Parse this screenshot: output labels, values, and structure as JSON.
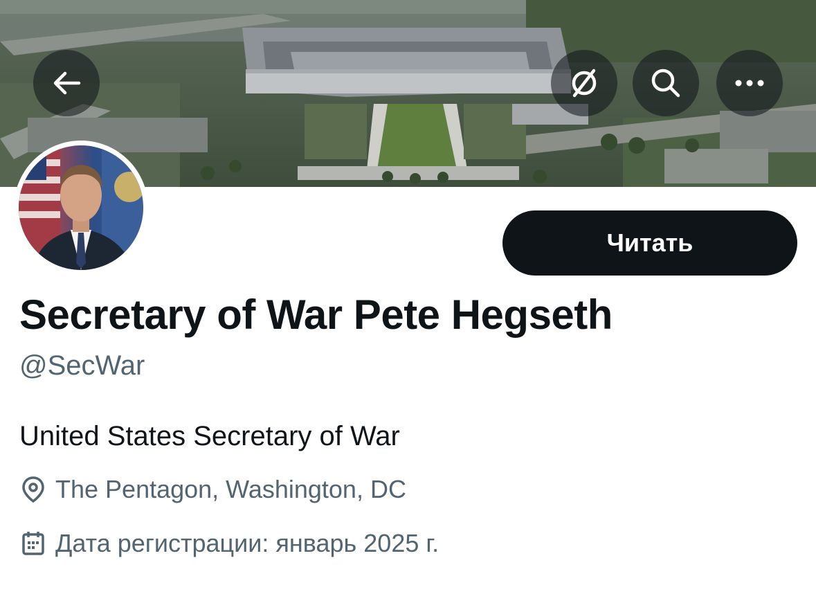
{
  "header": {
    "back_icon": "arrow-left-icon",
    "translate_icon": "slashed-circle-icon",
    "search_icon": "search-icon",
    "more_icon": "more-horizontal-icon"
  },
  "profile": {
    "display_name": "Secretary of War Pete Hegseth",
    "handle": "@SecWar",
    "follow_label": "Читать",
    "bio": "United States Secretary of War",
    "location": "The Pentagon, Washington, DC",
    "joined": "Дата регистрации: январь 2025 г."
  },
  "colors": {
    "primary_text": "#0f1419",
    "secondary_text": "#536471",
    "button_bg": "#0f1419",
    "button_text": "#ffffff"
  }
}
